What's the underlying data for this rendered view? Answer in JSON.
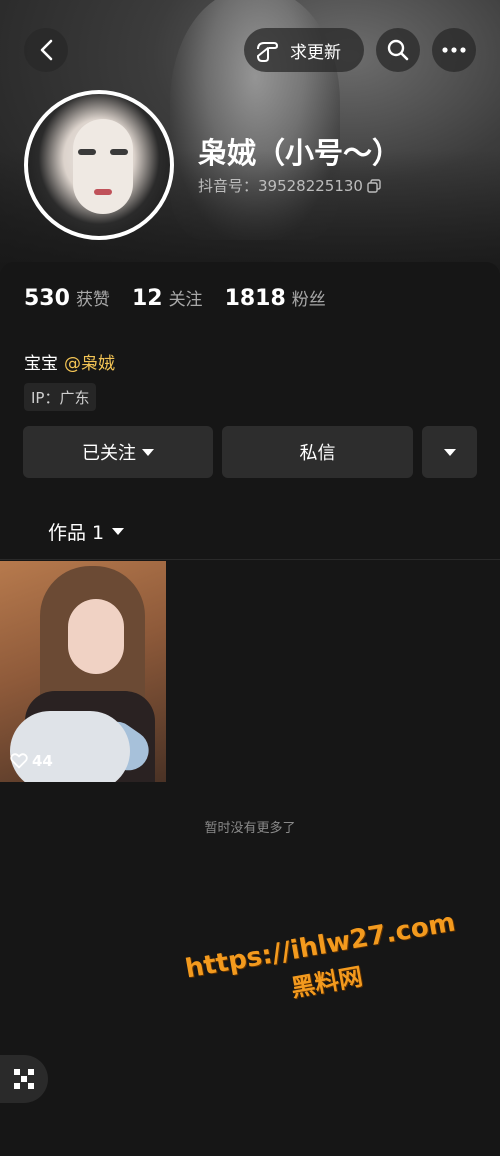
{
  "header": {
    "update_request_label": "求更新",
    "nickname": "枭娀（小号～）",
    "douyin_id": "抖音号：39528225130"
  },
  "stats": [
    {
      "value": "530",
      "label": "获赞"
    },
    {
      "value": "12",
      "label": "关注"
    },
    {
      "value": "1818",
      "label": "粉丝"
    }
  ],
  "bio": {
    "text": "宝宝",
    "mention": "@枭娀"
  },
  "ip_location": "IP：广东",
  "actions": {
    "followed_label": "已关注",
    "message_label": "私信"
  },
  "works_tab": {
    "label": "作品 1"
  },
  "video": {
    "likes": "44"
  },
  "no_more_text": "暂时没有更多了",
  "watermark": {
    "url": "https://ihlw27.com",
    "site_name": "黑料网"
  },
  "colors": {
    "background": "#161616",
    "mention": "#f3c455",
    "watermark": "#f39a1e"
  }
}
